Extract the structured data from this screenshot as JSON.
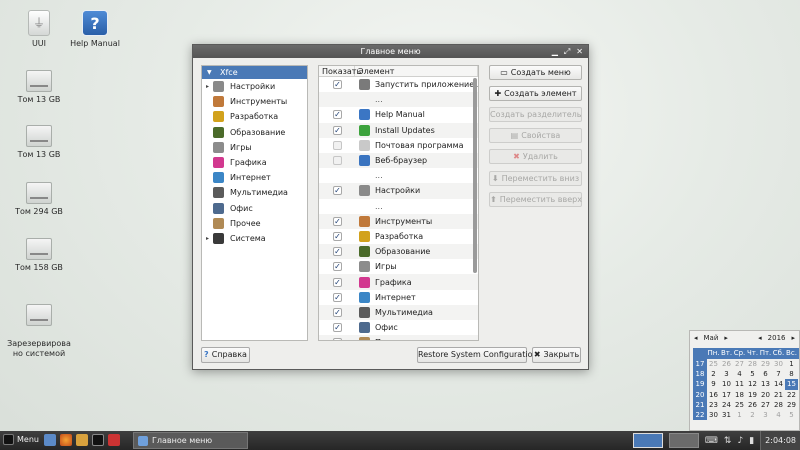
{
  "desktop": {
    "icons": [
      {
        "label": "UUI"
      },
      {
        "label": "Help Manual"
      },
      {
        "label": "Том 13 GB"
      },
      {
        "label": "Том 13 GB"
      },
      {
        "label": "Том 294 GB"
      },
      {
        "label": "Том 158 GB"
      },
      {
        "label": "Зарезервирова\nно системой"
      }
    ]
  },
  "window": {
    "title": "Главное меню",
    "tree_root": "Xfce",
    "categories": [
      {
        "label": "Настройки",
        "color": "#8a8a8a",
        "expandable": true
      },
      {
        "label": "Инструменты",
        "color": "#c0793a",
        "expandable": false
      },
      {
        "label": "Разработка",
        "color": "#d2a21c",
        "expandable": false
      },
      {
        "label": "Образование",
        "color": "#4b6b2a",
        "expandable": false
      },
      {
        "label": "Игры",
        "color": "#8c8c8c",
        "expandable": false
      },
      {
        "label": "Графика",
        "color": "#d2388f",
        "expandable": false
      },
      {
        "label": "Интернет",
        "color": "#3b86c6",
        "expandable": false
      },
      {
        "label": "Мультимедиа",
        "color": "#5b5b5b",
        "expandable": false
      },
      {
        "label": "Офис",
        "color": "#4e6a8e",
        "expandable": false
      },
      {
        "label": "Прочее",
        "color": "#b08a55",
        "expandable": false
      },
      {
        "label": "Система",
        "color": "#3a3a3a",
        "expandable": true
      }
    ],
    "columns": {
      "show": "Показать",
      "element": "Элемент"
    },
    "items": [
      {
        "label": "Запустить приложение...",
        "checked": true,
        "color": "#7a7a7a"
      },
      {
        "label": "...",
        "separator": true
      },
      {
        "label": "Help Manual",
        "checked": true,
        "color": "#3b76c4"
      },
      {
        "label": "Install Updates",
        "checked": true,
        "color": "#3da33d"
      },
      {
        "label": "Почтовая программа",
        "checked": false,
        "color": "#c9c9c9"
      },
      {
        "label": "Веб-браузер",
        "checked": false,
        "color": "#3a74c0"
      },
      {
        "label": "...",
        "separator": true
      },
      {
        "label": "Настройки",
        "checked": true,
        "color": "#8a8a8a"
      },
      {
        "label": "...",
        "separator": true
      },
      {
        "label": "Инструменты",
        "checked": true,
        "color": "#c0793a"
      },
      {
        "label": "Разработка",
        "checked": true,
        "color": "#d2a21c"
      },
      {
        "label": "Образование",
        "checked": true,
        "color": "#4b6b2a"
      },
      {
        "label": "Игры",
        "checked": true,
        "color": "#8c8c8c"
      },
      {
        "label": "Графика",
        "checked": true,
        "color": "#d2388f"
      },
      {
        "label": "Интернет",
        "checked": true,
        "color": "#3b86c6"
      },
      {
        "label": "Мультимедиа",
        "checked": true,
        "color": "#5b5b5b"
      },
      {
        "label": "Офис",
        "checked": true,
        "color": "#4e6a8e"
      },
      {
        "label": "Прочее",
        "checked": true,
        "color": "#b08a55"
      }
    ],
    "side_buttons": {
      "create_menu": "Создать меню",
      "create_item": "Создать элемент",
      "create_separator": "Создать разделитель",
      "properties": "Свойства",
      "delete": "Удалить",
      "move_down": "Переместить вниз",
      "move_up": "Переместить вверх"
    },
    "bottom": {
      "help": "Справка",
      "restore": "Restore System Configuration",
      "close": "Закрыть"
    }
  },
  "calendar": {
    "month": "Май",
    "year": "2016",
    "weekdays": [
      "Пн.",
      "Вт.",
      "Ср.",
      "Чт.",
      "Пт.",
      "Сб.",
      "Вс."
    ],
    "weeks": [
      {
        "num": "17",
        "days": [
          "25",
          "26",
          "27",
          "28",
          "29",
          "30",
          "1"
        ]
      },
      {
        "num": "18",
        "days": [
          "2",
          "3",
          "4",
          "5",
          "6",
          "7",
          "8"
        ]
      },
      {
        "num": "19",
        "days": [
          "9",
          "10",
          "11",
          "12",
          "13",
          "14",
          "15"
        ]
      },
      {
        "num": "20",
        "days": [
          "16",
          "17",
          "18",
          "19",
          "20",
          "21",
          "22"
        ]
      },
      {
        "num": "21",
        "days": [
          "23",
          "24",
          "25",
          "26",
          "27",
          "28",
          "29"
        ]
      },
      {
        "num": "22",
        "days": [
          "30",
          "31",
          "1",
          "2",
          "3",
          "4",
          "5"
        ]
      }
    ],
    "today": "15"
  },
  "taskbar": {
    "menu_label": "Menu",
    "task_title": "Главное меню",
    "clock": "2:04:08"
  }
}
